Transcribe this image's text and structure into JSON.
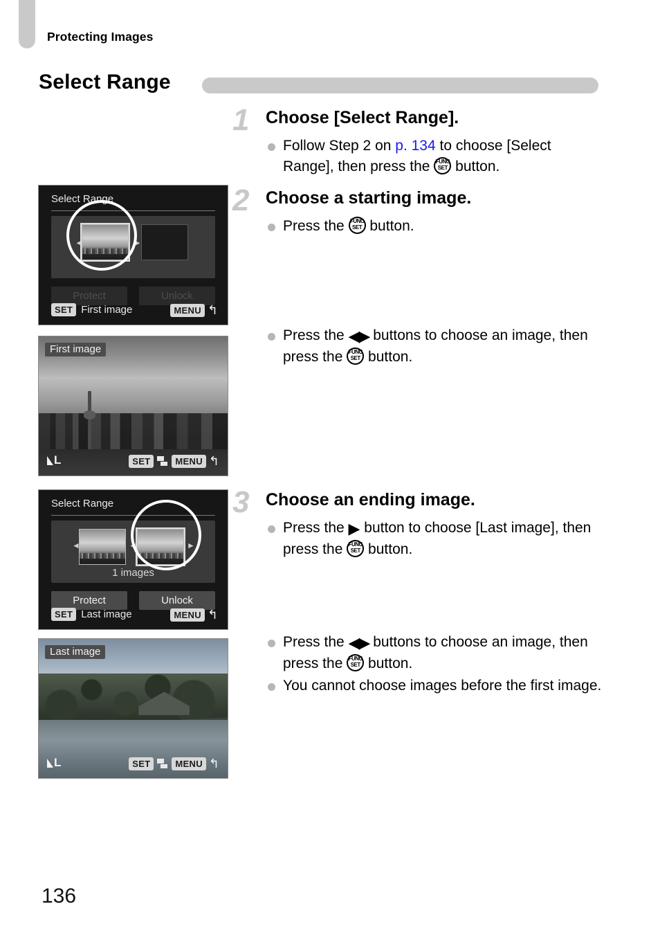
{
  "page": {
    "running_head": "Protecting Images",
    "section_title": "Select Range",
    "page_number": "136"
  },
  "steps": [
    {
      "number": "1",
      "heading": "Choose [Select Range].",
      "bullets": [
        {
          "pre": "Follow Step 2 on ",
          "link": "p. 134",
          "post": " to choose [Select Range], then press the ",
          "icon": "func-set-button-icon",
          "tail": " button."
        }
      ]
    },
    {
      "number": "2",
      "heading": "Choose a starting image.",
      "bullets": [
        {
          "pre": "Press the ",
          "icon": "func-set-button-icon",
          "tail": " button."
        }
      ],
      "bullets_late": [
        {
          "pre": "Press the ",
          "icon": "left-right-arrows-icon",
          "mid": " buttons to choose an image, then press the ",
          "icon2": "func-set-button-icon",
          "tail": " button."
        }
      ]
    },
    {
      "number": "3",
      "heading": "Choose an ending image.",
      "bullets": [
        {
          "pre": "Press the ",
          "icon": "right-arrow-icon",
          "mid": " button to choose [Last image], then press the ",
          "icon2": "func-set-button-icon",
          "tail": " button."
        }
      ],
      "bullets_late": [
        {
          "pre": "Press the ",
          "icon": "left-right-arrows-icon",
          "mid": " buttons to choose an image, then press the ",
          "icon2": "func-set-button-icon",
          "tail": " button."
        },
        {
          "text": "You cannot choose images before the first image."
        }
      ]
    }
  ],
  "screens": [
    {
      "id": "select-range-first",
      "title": "Select Range",
      "count_label": "",
      "protect_label": "Protect",
      "unlock_label": "Unlock",
      "buttons_dimmed": true,
      "set_badge": "SET",
      "set_label": "First image",
      "menu_badge": "MENU",
      "return_arrow": "↰"
    },
    {
      "id": "first-image-preview",
      "image_label": "First image",
      "quality": "L",
      "set_badge": "SET",
      "menu_badge": "MENU",
      "return_arrow": "↰",
      "protect_icon": "protect-icon"
    },
    {
      "id": "select-range-last",
      "title": "Select Range",
      "count_label": "1 images",
      "protect_label": "Protect",
      "unlock_label": "Unlock",
      "buttons_dimmed": false,
      "set_badge": "SET",
      "set_label": "Last image",
      "menu_badge": "MENU",
      "return_arrow": "↰"
    },
    {
      "id": "last-image-preview",
      "image_label": "Last image",
      "quality": "L",
      "set_badge": "SET",
      "menu_badge": "MENU",
      "return_arrow": "↰",
      "protect_icon": "protect-icon"
    }
  ],
  "func_set_icon": {
    "top": "FUNC",
    "bottom": "SET"
  },
  "glyphs": {
    "left_right": "◀▶",
    "right": "▶"
  },
  "colors": {
    "accent_gray": "#c9c9c9",
    "link_blue": "#1a1aee",
    "step_number": "#c8c8c8",
    "bullet": "#b6b6b6",
    "screen_bg": "#161616"
  }
}
